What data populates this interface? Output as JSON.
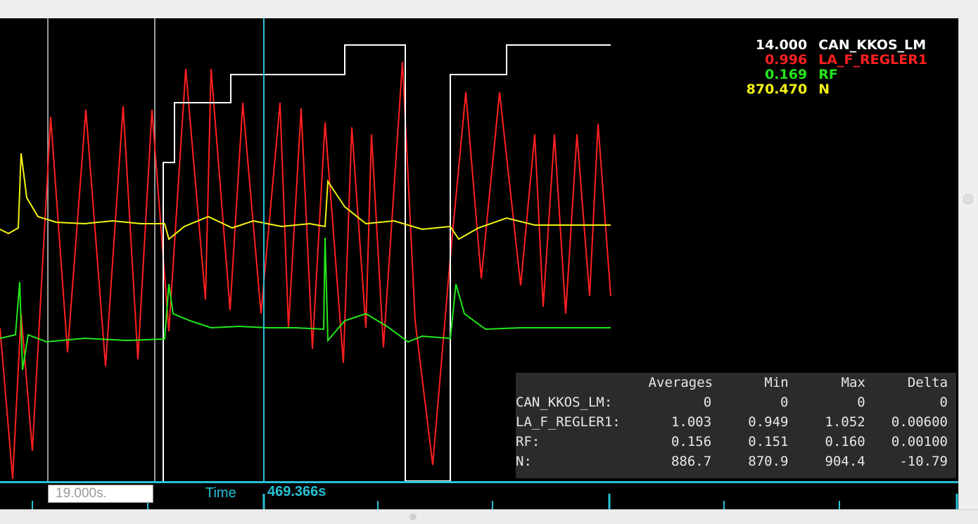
{
  "legend": [
    {
      "value": "14.000",
      "name": "CAN_KKOS_LM",
      "color": "#ffffff"
    },
    {
      "value": "0.996",
      "name": "LA_F_REGLER1",
      "color": "#ff2020"
    },
    {
      "value": "0.169",
      "name": "RF",
      "color": "#22e81a"
    },
    {
      "value": "870.470",
      "name": "N",
      "color": "#f3f312"
    }
  ],
  "stats": {
    "headers": [
      "",
      "Averages",
      "Min",
      "Max",
      "Delta"
    ],
    "rows": [
      {
        "label": "CAN_KKOS_LM:",
        "avg": "0",
        "min": "0",
        "max": "0",
        "delta": "0"
      },
      {
        "label": "LA_F_REGLER1:",
        "avg": "1.003",
        "min": "0.949",
        "max": "1.052",
        "delta": "0.00600"
      },
      {
        "label": "RF:",
        "avg": "0.156",
        "min": "0.151",
        "max": "0.160",
        "delta": "0.00100"
      },
      {
        "label": "N:",
        "avg": "886.7",
        "min": "870.9",
        "max": "904.4",
        "delta": "-10.79"
      }
    ]
  },
  "timebar": {
    "span_value": "19.000s.",
    "time_label": "Time",
    "cursor_time": "469.366s"
  },
  "colors": {
    "cursor": "#27c1d6",
    "background": "#000000",
    "gridline": "#8a8a8a"
  }
}
